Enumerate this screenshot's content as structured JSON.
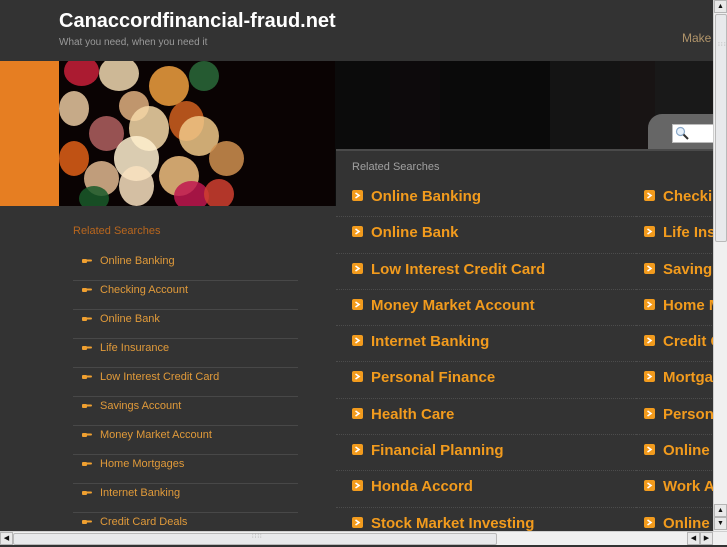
{
  "header": {
    "site_title": "Canaccordfinancial-fraud.net",
    "tagline": "What you need, when you need it",
    "make_link": "Make"
  },
  "search": {
    "icon": "search-icon",
    "placeholder": ""
  },
  "sidebar": {
    "heading": "Related Searches",
    "item_icon": "pointing-hand-icon",
    "items": [
      {
        "label": "Online Banking"
      },
      {
        "label": "Checking Account"
      },
      {
        "label": "Online Bank"
      },
      {
        "label": "Life Insurance"
      },
      {
        "label": "Low Interest Credit Card"
      },
      {
        "label": "Savings Account"
      },
      {
        "label": "Money Market Account"
      },
      {
        "label": "Home Mortgages"
      },
      {
        "label": "Internet Banking"
      },
      {
        "label": "Credit Card Deals"
      }
    ]
  },
  "main": {
    "heading": "Related Searches",
    "item_icon": "chevron-right-icon",
    "left_column": [
      {
        "label": "Online Banking"
      },
      {
        "label": "Online Bank"
      },
      {
        "label": "Low Interest Credit Card"
      },
      {
        "label": "Money Market Account"
      },
      {
        "label": "Internet Banking"
      },
      {
        "label": "Personal Finance"
      },
      {
        "label": "Health Care"
      },
      {
        "label": "Financial Planning"
      },
      {
        "label": "Honda Accord"
      },
      {
        "label": "Stock Market Investing"
      }
    ],
    "right_column": [
      {
        "label": "Checki"
      },
      {
        "label": "Life Ins"
      },
      {
        "label": "Saving"
      },
      {
        "label": "Home M"
      },
      {
        "label": "Credit C"
      },
      {
        "label": "Mortga"
      },
      {
        "label": "Person"
      },
      {
        "label": "Online"
      },
      {
        "label": "Work A"
      },
      {
        "label": "Online"
      }
    ]
  },
  "scrollbars": {
    "vertical_icons": [
      "scroll-up-icon",
      "scroll-down-icon"
    ],
    "horizontal_icons": [
      "scroll-left-icon",
      "scroll-right-icon"
    ]
  },
  "colors": {
    "accent_orange": "#f29b1d",
    "banner_orange": "#e67e22",
    "background": "#333333",
    "title_white": "#ffffff"
  }
}
